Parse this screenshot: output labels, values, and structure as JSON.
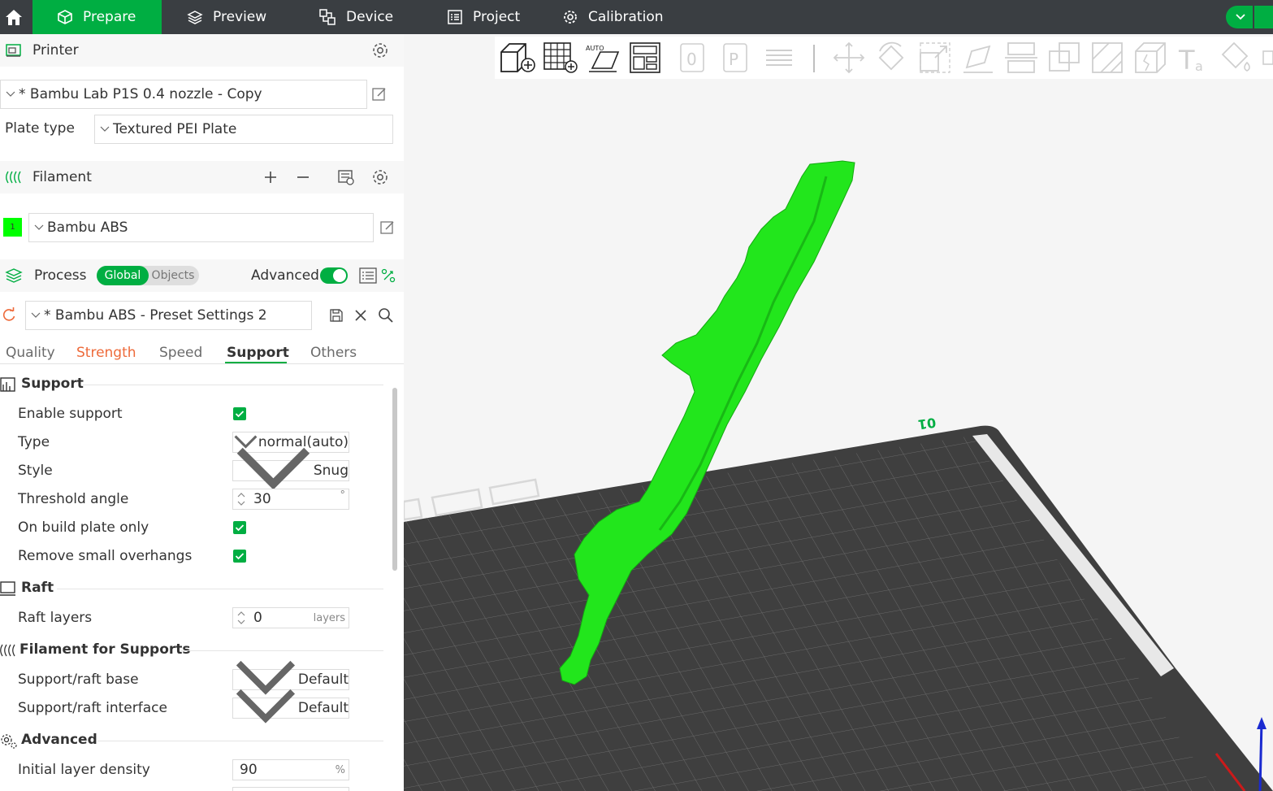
{
  "topbar": {
    "tabs": [
      {
        "label": "Prepare",
        "icon": "cube-icon",
        "active": true
      },
      {
        "label": "Preview",
        "icon": "layers-icon",
        "active": false
      },
      {
        "label": "Device",
        "icon": "device-icon",
        "active": false
      },
      {
        "label": "Project",
        "icon": "project-icon",
        "active": false
      },
      {
        "label": "Calibration",
        "icon": "calibration-icon",
        "active": false
      }
    ]
  },
  "printer": {
    "title": "Printer",
    "preset": "* Bambu Lab P1S 0.4 nozzle - Copy",
    "plate_type_label": "Plate type",
    "plate_type_value": "Textured PEI Plate"
  },
  "filament": {
    "title": "Filament",
    "slot_number": "1",
    "slot_color": "#00ff00",
    "name": "Bambu ABS"
  },
  "process": {
    "title": "Process",
    "toggle_global": "Global",
    "toggle_objects": "Objects",
    "advanced_label": "Advanced",
    "advanced_on": true,
    "preset": "* Bambu ABS - Preset Settings 2",
    "tabs": [
      "Quality",
      "Strength",
      "Speed",
      "Support",
      "Others"
    ],
    "active_tab": "Support",
    "modified_tab": "Strength"
  },
  "support": {
    "group_title": "Support",
    "enable_support": {
      "label": "Enable support",
      "checked": true
    },
    "type": {
      "label": "Type",
      "value": "normal(auto)"
    },
    "style": {
      "label": "Style",
      "value": "Snug"
    },
    "threshold_angle": {
      "label": "Threshold angle",
      "value": "30",
      "unit": "°"
    },
    "on_build_plate_only": {
      "label": "On build plate only",
      "checked": true
    },
    "remove_small_overhangs": {
      "label": "Remove small overhangs",
      "checked": true
    }
  },
  "raft": {
    "group_title": "Raft",
    "raft_layers": {
      "label": "Raft layers",
      "value": "0",
      "unit": "layers"
    }
  },
  "filament_for_supports": {
    "group_title": "Filament for Supports",
    "base": {
      "label": "Support/raft base",
      "value": "Default"
    },
    "interface": {
      "label": "Support/raft interface",
      "value": "Default"
    }
  },
  "advanced": {
    "group_title": "Advanced",
    "initial_layer_density": {
      "label": "Initial layer density",
      "value": "90",
      "unit": "%"
    }
  },
  "viewport": {
    "plate_label": "01",
    "model_color": "#22e61c",
    "accent_color": "#00ae42"
  }
}
